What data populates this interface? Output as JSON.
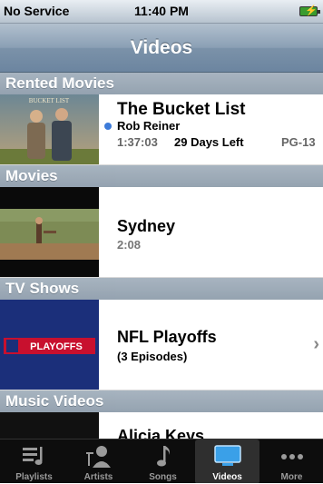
{
  "status": {
    "carrier": "No Service",
    "time": "11:40 PM"
  },
  "nav": {
    "title": "Videos"
  },
  "sections": {
    "rented": "Rented Movies",
    "movies": "Movies",
    "tv": "TV Shows",
    "music": "Music Videos"
  },
  "rented_item": {
    "poster_text": "BUCKET LIST",
    "title": "The Bucket List",
    "director": "Rob Reiner",
    "duration": "1:37:03",
    "days_left": "29 Days Left",
    "rating": "PG-13"
  },
  "movie_item": {
    "title": "Sydney",
    "duration": "2:08"
  },
  "tv_item": {
    "poster_text": "PLAYOFFS",
    "title": "NFL Playoffs",
    "episodes": "(3 Episodes)"
  },
  "music_item": {
    "title": "Alicia Keys"
  },
  "tabs": [
    {
      "label": "Playlists",
      "icon": "playlists-icon"
    },
    {
      "label": "Artists",
      "icon": "artists-icon"
    },
    {
      "label": "Songs",
      "icon": "songs-icon"
    },
    {
      "label": "Videos",
      "icon": "videos-icon"
    },
    {
      "label": "More",
      "icon": "more-icon"
    }
  ],
  "colors": {
    "accent_dot": "#3d7bd9",
    "nav_bar": "#7b92a9"
  }
}
